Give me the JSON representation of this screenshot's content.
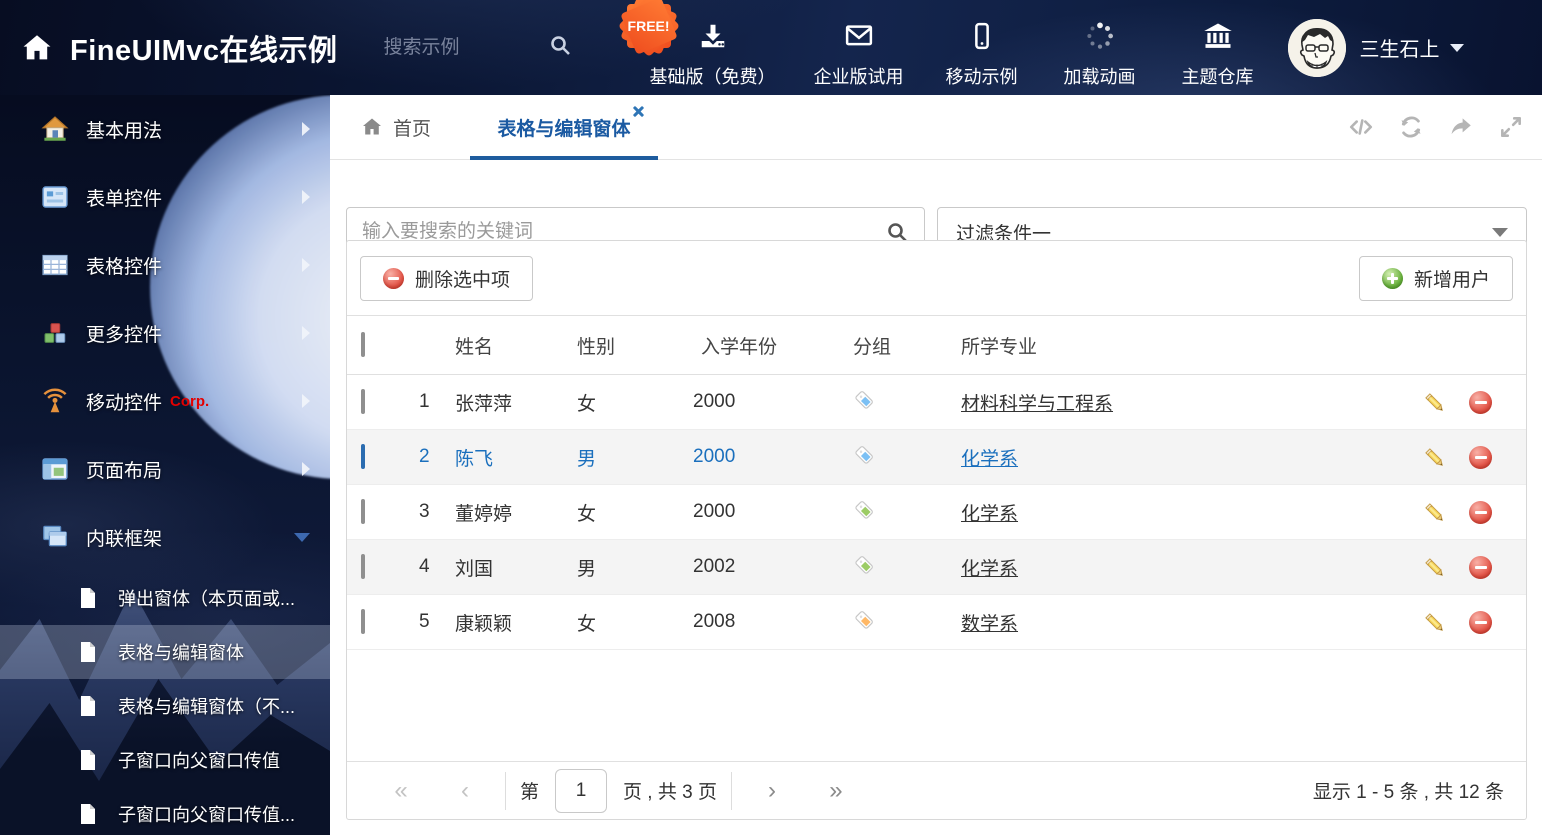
{
  "header": {
    "title": "FineUIMvc在线示例",
    "search_placeholder": "搜索示例",
    "free_badge": "FREE!",
    "nav": [
      {
        "label": "基础版（免费）",
        "icon": "download-icon"
      },
      {
        "label": "企业版试用",
        "icon": "envelope-icon"
      },
      {
        "label": "移动示例",
        "icon": "mobile-icon"
      },
      {
        "label": "加载动画",
        "icon": "spinner-icon"
      },
      {
        "label": "主题仓库",
        "icon": "bank-icon"
      }
    ],
    "user": {
      "name": "三生石上"
    }
  },
  "sidebar": {
    "items": [
      {
        "label": "基本用法"
      },
      {
        "label": "表单控件"
      },
      {
        "label": "表格控件"
      },
      {
        "label": "更多控件"
      },
      {
        "label": "移动控件",
        "badge": "Corp."
      },
      {
        "label": "页面布局"
      },
      {
        "label": "内联框架"
      }
    ],
    "subitems": [
      {
        "label": "弹出窗体（本页面或..."
      },
      {
        "label": "表格与编辑窗体"
      },
      {
        "label": "表格与编辑窗体（不..."
      },
      {
        "label": "子窗口向父窗口传值"
      },
      {
        "label": "子窗口向父窗口传值..."
      }
    ]
  },
  "tabs": {
    "home": "首页",
    "active": "表格与编辑窗体"
  },
  "toolbar": {
    "search_placeholder": "输入要搜索的关键词",
    "filter_value": "过滤条件一",
    "delete_label": "删除选中项",
    "add_label": "新增用户"
  },
  "table": {
    "columns": [
      "姓名",
      "性别",
      "入学年份",
      "分组",
      "所学专业"
    ],
    "rows": [
      {
        "num": "1",
        "name": "张萍萍",
        "gender": "女",
        "year": "2000",
        "tag_color": "#7cc0f4",
        "major": "材料科学与工程系"
      },
      {
        "num": "2",
        "name": "陈飞",
        "gender": "男",
        "year": "2000",
        "tag_color": "#7cc0f4",
        "major": "化学系"
      },
      {
        "num": "3",
        "name": "董婷婷",
        "gender": "女",
        "year": "2000",
        "tag_color": "#9ccc65",
        "major": "化学系"
      },
      {
        "num": "4",
        "name": "刘国",
        "gender": "男",
        "year": "2002",
        "tag_color": "#9ccc65",
        "major": "化学系"
      },
      {
        "num": "5",
        "name": "康颖颖",
        "gender": "女",
        "year": "2008",
        "tag_color": "#ffb866",
        "major": "数学系"
      }
    ]
  },
  "pagination": {
    "prefix": "第",
    "page_input": "1",
    "suffix": "页 , 共 3 页",
    "summary": "显示 1 - 5 条 , 共 12 条"
  },
  "colors": {
    "accent_blue": "#1e5c9e",
    "selected_text": "#1a6fbd",
    "delete_red": "#d9534f",
    "add_green": "#5cb85c",
    "header_bg": "#0d1c3e"
  }
}
